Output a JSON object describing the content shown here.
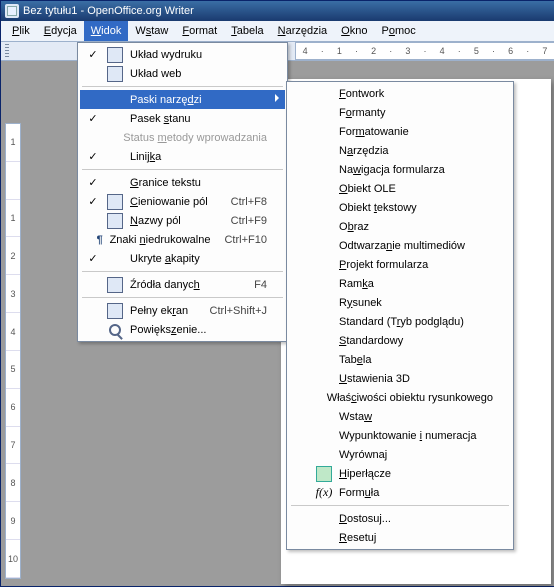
{
  "title": "Bez tytułu1 - OpenOffice.org Writer",
  "menubar": [
    "Plik",
    "Edycja",
    "Widok",
    "Wstaw",
    "Format",
    "Tabela",
    "Narzędzia",
    "Okno",
    "Pomoc"
  ],
  "menubar_u": [
    0,
    0,
    0,
    1,
    0,
    0,
    0,
    0,
    1
  ],
  "ruler_marks": [
    "4",
    "1",
    "2",
    "3",
    "4",
    "5",
    "6",
    "7"
  ],
  "vruler_marks": [
    "1",
    "-",
    "1",
    "2",
    "3",
    "4",
    "5",
    "6",
    "7",
    "8",
    "9",
    "10"
  ],
  "view": {
    "uklad_wydruku": "Układ wydruku",
    "uklad_web": "Układ web",
    "paski": "Paski narzędzi",
    "pasek_stanu": "Pasek stanu",
    "status_metody": "Status metody wprowadzania",
    "linijka": "Linijka",
    "granice": "Granice tekstu",
    "cieniowanie": "Cieniowanie pól",
    "cieniowanie_k": "Ctrl+F8",
    "nazwy": "Nazwy pól",
    "nazwy_k": "Ctrl+F9",
    "znaki": "Znaki niedrukowalne",
    "znaki_k": "Ctrl+F10",
    "ukryte": "Ukryte akapity",
    "zrodla": "Źródła danych",
    "zrodla_k": "F4",
    "pelny": "Pełny ekran",
    "pelny_k": "Ctrl+Shift+J",
    "powiekszenie": "Powiększenie..."
  },
  "toolbars": {
    "fontwork": "Fontwork",
    "formanty": "Formanty",
    "formatowanie": "Formatowanie",
    "narzedzia": "Narzędzia",
    "nawigacja": "Nawigacja formularza",
    "obiekt_ole": "Obiekt OLE",
    "obiekt_tekst": "Obiekt tekstowy",
    "obraz": "Obraz",
    "odtwarzanie": "Odtwarzanie multimediów",
    "projekt": "Projekt formularza",
    "ramka": "Ramka",
    "rysunek": "Rysunek",
    "standard_tp": "Standard (Tryb podglądu)",
    "standardowy": "Standardowy",
    "tabela": "Tabela",
    "ust3d": "Ustawienia 3D",
    "wlasciwosci": "Właściwości obiektu rysunkowego",
    "wstaw": "Wstaw",
    "wypunkt": "Wypunktowanie i numeracja",
    "wyrownaj": "Wyrównaj",
    "hiperlacze": "Hiperłącze",
    "formula": "Formuła",
    "dostosuj": "Dostosuj...",
    "resetuj": "Resetuj"
  }
}
